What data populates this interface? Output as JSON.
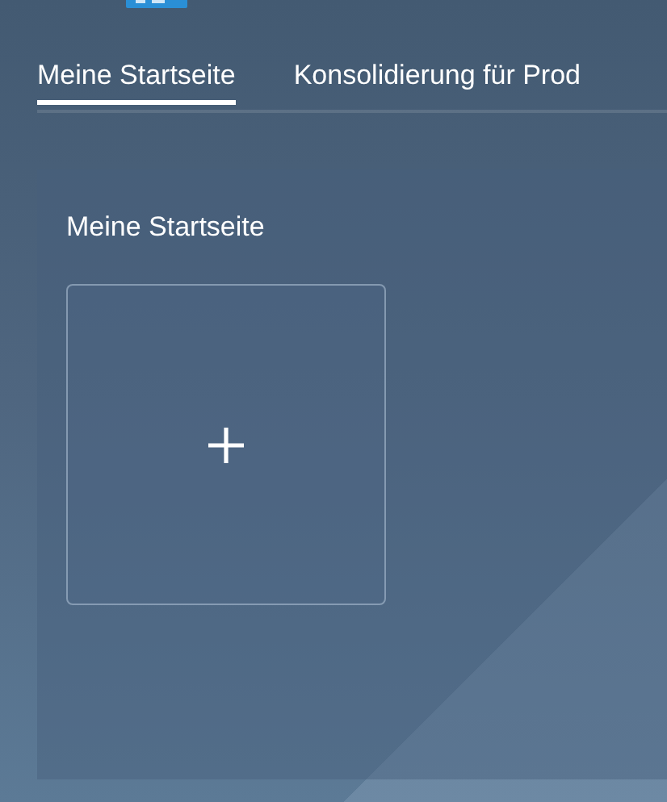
{
  "tabs": [
    {
      "label": "Meine Startseite",
      "selected": true
    },
    {
      "label": "Konsolidierung für Prod",
      "selected": false
    }
  ],
  "section": {
    "title": "Meine Startseite"
  }
}
